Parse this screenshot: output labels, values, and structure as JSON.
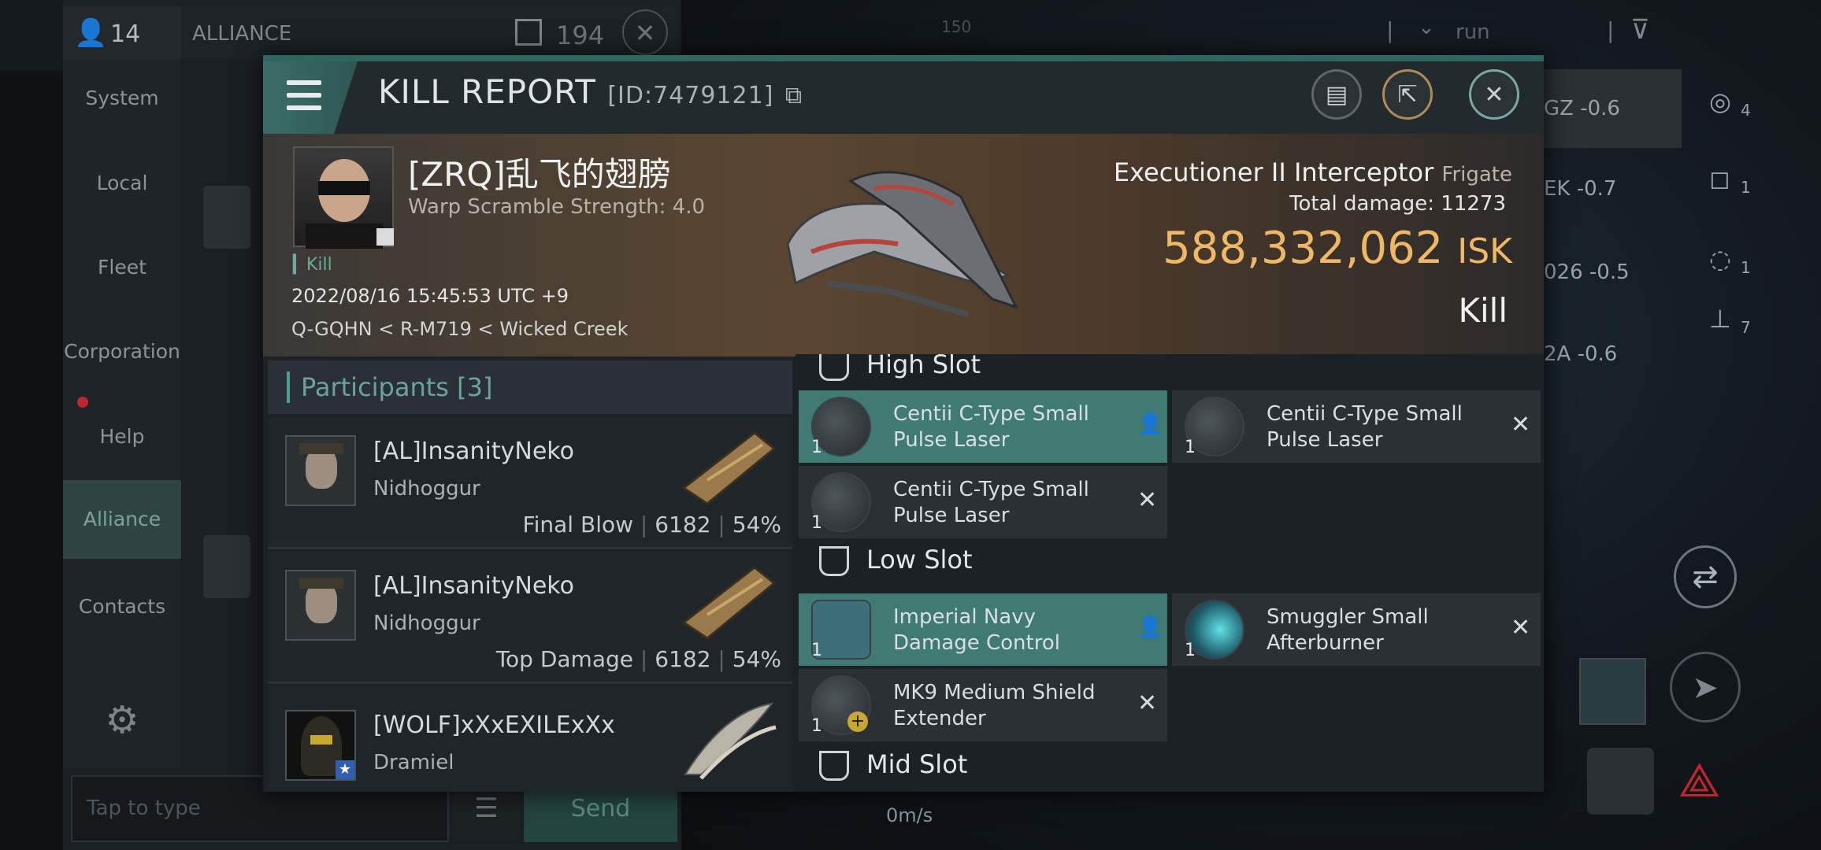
{
  "topbar": {
    "online_count": "14",
    "channel": "ALLIANCE",
    "unread_count": "194",
    "range_label": "run",
    "map_tick": "150"
  },
  "sidebar": {
    "items": [
      {
        "label": "System"
      },
      {
        "label": "Local"
      },
      {
        "label": "Fleet"
      },
      {
        "label": "Corporation"
      },
      {
        "label": "Help"
      },
      {
        "label": "Alliance"
      },
      {
        "label": "Contacts"
      }
    ]
  },
  "chat": {
    "placeholder": "Tap to type",
    "send_label": "Send"
  },
  "overview": {
    "rows": [
      {
        "label": "GZ -0.6"
      },
      {
        "label": "EK -0.7"
      },
      {
        "label": "026 -0.5"
      },
      {
        "label": "2A -0.6"
      }
    ],
    "counts": [
      "4",
      "1",
      "1",
      "7"
    ]
  },
  "hud": {
    "speed": "0m/s"
  },
  "report": {
    "title": "KILL REPORT",
    "id_label": "[ID:7479121]",
    "victim": {
      "name": "[ZRQ]乱飞的翅膀",
      "scramble": "Warp Scramble Strength: 4.0",
      "kill_tag": "Kill",
      "datetime": "2022/08/16 15:45:53 UTC +9",
      "location": "Q-GQHN < R-M719 < Wicked Creek"
    },
    "ship": {
      "name": "Executioner II Interceptor",
      "class": "Frigate",
      "total_damage_label": "Total damage:",
      "total_damage": "11273",
      "isk_value": "588,332,062",
      "isk_unit": "ISK",
      "result": "Kill"
    },
    "participants_title": "Participants [3]",
    "participants": [
      {
        "name": "[AL]InsanityNeko",
        "ship": "Nidhoggur",
        "role": "Final Blow",
        "damage": "6182",
        "percent": "54%"
      },
      {
        "name": "[AL]InsanityNeko",
        "ship": "Nidhoggur",
        "role": "Top Damage",
        "damage": "6182",
        "percent": "54%"
      },
      {
        "name": "[WOLF]xXxEXILExXx",
        "ship": "Dramiel",
        "role": "",
        "damage": "",
        "percent": ""
      }
    ],
    "slots": {
      "high_title": "High Slot",
      "low_title": "Low Slot",
      "mid_title": "Mid Slot",
      "high": [
        {
          "name": "Centii C-Type Small Pulse Laser",
          "qty": "1"
        },
        {
          "name": "Centii C-Type Small Pulse Laser",
          "qty": "1"
        },
        {
          "name": "Centii C-Type Small Pulse Laser",
          "qty": "1"
        }
      ],
      "low": [
        {
          "name": "Imperial Navy Damage Control",
          "qty": "1"
        },
        {
          "name": "Smuggler Small Afterburner",
          "qty": "1"
        },
        {
          "name": "MK9 Medium Shield Extender",
          "qty": "1"
        }
      ]
    }
  }
}
